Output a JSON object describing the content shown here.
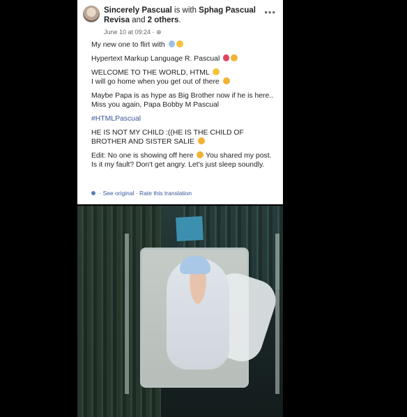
{
  "post": {
    "author": "Sincerely Pascual",
    "with_text": " is with ",
    "tagged": "Sphag Pascual Revisa",
    "and_text": " and ",
    "others": "2 others",
    "period": ".",
    "date": "June 10 at 09:24 ·",
    "menu_label": "•••",
    "lines": [
      "My new one to flirt with",
      "Hypertext Markup Language R. Pascual",
      "WELCOME TO THE WORLD, HTML",
      "I will go home when you get out of there",
      "Maybe Papa is as hype as Big Brother now if he is here.. Miss you again, Papa Bobby M Pascual",
      "#HTMLPascual",
      "HE IS NOT MY CHILD :((HE IS THE CHILD OF BROTHER AND SISTER SALIE",
      "Edit: No one is showing off here",
      " You shared my post. Is it my fault? Don't get angry. Let's just sleep soundly."
    ],
    "see_original": "See original",
    "separator": " · ",
    "rate_translation": "Rate this translation"
  },
  "photo": {
    "subject": "newborn-in-hospital-bassinet"
  }
}
